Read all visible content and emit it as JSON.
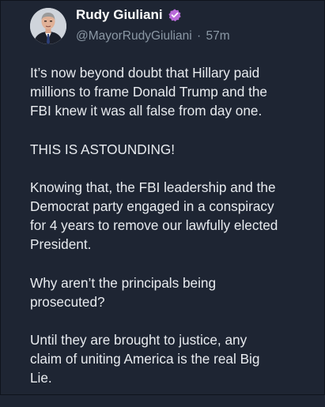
{
  "author": {
    "name": "Rudy Giuliani",
    "handle": "@MayorRudyGiuliani",
    "separator": "·",
    "time": "57m",
    "verified_icon": "verified-badge-icon",
    "verified_color": "#b86ad8"
  },
  "tweet": {
    "paragraphs": [
      "It’s now beyond doubt that Hillary paid\nmillions to frame Donald Trump and the\nFBI knew it was all false from day one.",
      "THIS IS ASTOUNDING!",
      "Knowing that, the FBI leadership and the\nDemocrat party engaged in a conspiracy\nfor 4 years to remove our lawfully elected\nPresident.",
      "Why aren’t the principals being\nprosecuted?",
      "Until they are brought to justice, any\nclaim of uniting America is the real Big\nLie."
    ]
  },
  "colors": {
    "background": "#1e2533",
    "text": "#e8ebef",
    "muted": "#8b98a5"
  }
}
